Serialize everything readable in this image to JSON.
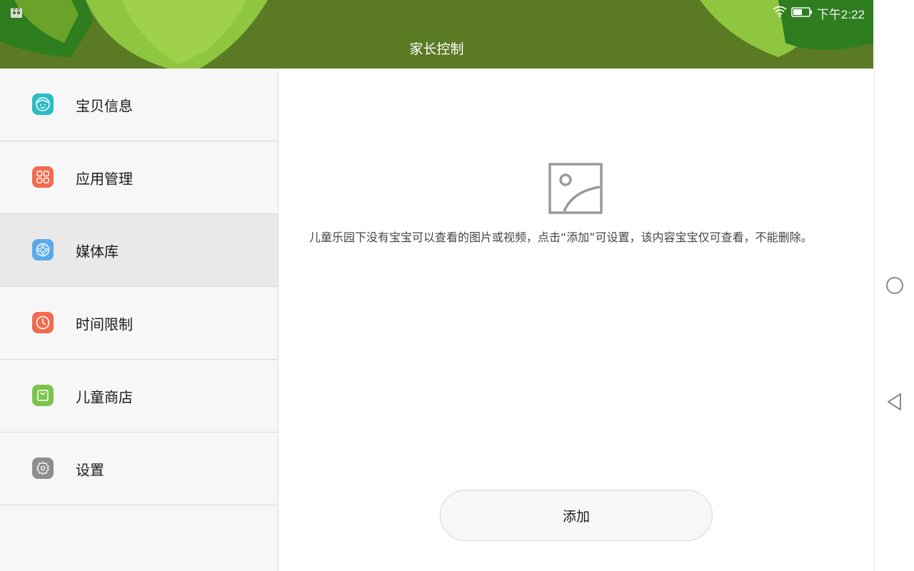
{
  "status_bar": {
    "time": "下午2:22",
    "left_icon": "app-notification-icon",
    "wifi_icon": "wifi-icon",
    "battery_icon": "battery-icon"
  },
  "header": {
    "title": "家长控制"
  },
  "sidebar": {
    "items": [
      {
        "label": "宝贝信息",
        "icon": "baby-face-icon",
        "color": "#2bbdc4"
      },
      {
        "label": "应用管理",
        "icon": "app-grid-icon",
        "color": "#f26a4f"
      },
      {
        "label": "媒体库",
        "icon": "media-reel-icon",
        "color": "#5aa9ea"
      },
      {
        "label": "时间限制",
        "icon": "clock-icon",
        "color": "#f26a4f"
      },
      {
        "label": "儿童商店",
        "icon": "shopping-bag-icon",
        "color": "#7cc44e"
      },
      {
        "label": "设置",
        "icon": "gear-icon",
        "color": "#8e8e8e"
      }
    ],
    "active_index": 2
  },
  "content": {
    "empty_message": "儿童乐园下没有宝宝可以查看的图片或视频，点击“添加”可设置，该内容宝宝仅可查看，不能删除。",
    "add_button_label": "添加",
    "placeholder_icon": "image-placeholder-icon"
  },
  "colors": {
    "header_bg": "#5a7a23",
    "leaf_light": "#8ec63f",
    "leaf_dark": "#2e7d1f"
  }
}
